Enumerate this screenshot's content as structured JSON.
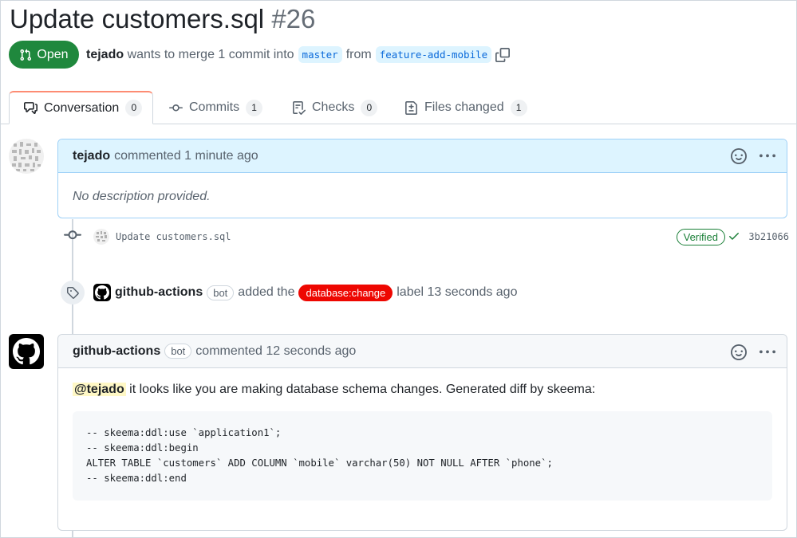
{
  "pr": {
    "title": "Update customers.sql",
    "number": "#26",
    "state": "Open",
    "author": "tejado",
    "merge_text": "wants to merge 1 commit into",
    "base_branch": "master",
    "from_text": "from",
    "head_branch": "feature-add-mobile"
  },
  "tabs": [
    {
      "label": "Conversation",
      "count": "0"
    },
    {
      "label": "Commits",
      "count": "1"
    },
    {
      "label": "Checks",
      "count": "0"
    },
    {
      "label": "Files changed",
      "count": "1"
    }
  ],
  "first_comment": {
    "author": "tejado",
    "action": "commented 1 minute ago",
    "body": "No description provided."
  },
  "commit": {
    "message": "Update customers.sql",
    "verified": "Verified",
    "sha": "3b21066"
  },
  "label_event": {
    "actor": "github-actions",
    "bot": "bot",
    "pre": "added the",
    "label": "database:change",
    "post": "label 13 seconds ago",
    "label_color": "#ee0701"
  },
  "bot_comment": {
    "author": "github-actions",
    "bot": "bot",
    "action": "commented 12 seconds ago",
    "mention": "@tejado",
    "text": " it looks like you are making database schema changes. Generated diff by skeema:",
    "code": "-- skeema:ddl:use `application1`;\n-- skeema:ddl:begin\nALTER TABLE `customers` ADD COLUMN `mobile` varchar(50) NOT NULL AFTER `phone`;\n-- skeema:ddl:end"
  },
  "colors": {
    "open_green": "#1f883d",
    "link_blue": "#0969da",
    "verified_green": "#1a7f37"
  }
}
